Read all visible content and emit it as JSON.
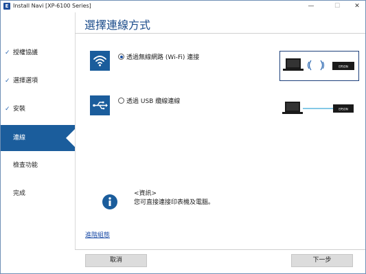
{
  "window": {
    "title": "Install Navi [XP-6100 Series]",
    "app_icon": "E",
    "controls": {
      "minimize": "—",
      "maximize": "☐",
      "close": "✕"
    }
  },
  "sidebar": {
    "items": [
      {
        "label": "授權協議",
        "state": "done"
      },
      {
        "label": "選擇選項",
        "state": "done"
      },
      {
        "label": "安裝",
        "state": "done"
      },
      {
        "label": "連線",
        "state": "active"
      },
      {
        "label": "檢查功能",
        "state": "pending"
      },
      {
        "label": "完成",
        "state": "pending"
      }
    ],
    "check_glyph": "✓"
  },
  "main": {
    "title": "選擇連線方式",
    "options": [
      {
        "label": "透過無線網路 (Wi-Fi) 連接",
        "selected": true,
        "icon": "wifi-icon",
        "diagram": "laptop-wifi-printer"
      },
      {
        "label": "透過 USB 纜線連線",
        "selected": false,
        "icon": "usb-icon",
        "diagram": "laptop-usb-printer"
      }
    ],
    "printer_brand": "EPSON",
    "info": {
      "title": "<資訊>",
      "text": "您可直接連接印表機及電腦。",
      "icon": "info-icon"
    },
    "advanced_link": "進階組態"
  },
  "footer": {
    "cancel_label": "取消",
    "next_label": "下一步"
  },
  "colors": {
    "accent": "#1b5d9c",
    "title": "#1a4b8a",
    "link": "#1f4fa8",
    "button": "#dcdcdc"
  }
}
